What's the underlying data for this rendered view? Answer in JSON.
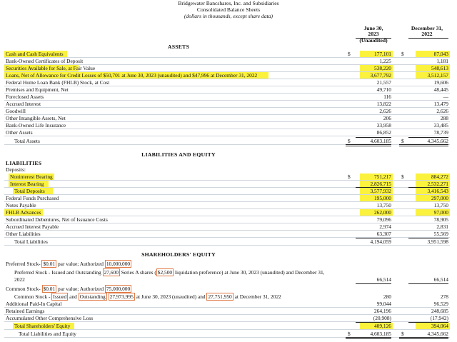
{
  "header": {
    "company": "Bridgewater Bancshares, Inc. and Subsidiaries",
    "statement": "Consolidated Balance Sheets",
    "units": "(dollars in thousands, except share data)"
  },
  "columns": {
    "col1_line1": "June 30,",
    "col1_line2": "2023",
    "col1_line3": "(Unaudited)",
    "col2_line1": "December 31,",
    "col2_line2": "2022"
  },
  "currency": "$",
  "assets": {
    "heading": "ASSETS",
    "rows": [
      {
        "label": "Cash and Cash Equivalents",
        "v1": "177,101",
        "v2": "87,043"
      },
      {
        "label": "Bank-Owned Certificates of Deposit",
        "v1": "1,225",
        "v2": "1,181"
      },
      {
        "label": "Securities Available for Sale, at Fair Value",
        "v1": "538,220",
        "v2": "548,613"
      },
      {
        "label": "Loans, Net of Allowance for Credit Losses of $50,701 at June 30, 2023 (unaudited) and $47,996 at December 31, 2022",
        "v1": "3,677,792",
        "v2": "3,512,157"
      },
      {
        "label": "Federal Home Loan Bank (FHLB) Stock, at Cost",
        "v1": "21,557",
        "v2": "19,606"
      },
      {
        "label": "Premises and Equipment, Net",
        "v1": "49,710",
        "v2": "48,445"
      },
      {
        "label": "Foreclosed Assets",
        "v1": "116",
        "v2": "—"
      },
      {
        "label": "Accrued Interest",
        "v1": "13,822",
        "v2": "13,479"
      },
      {
        "label": "Goodwill",
        "v1": "2,626",
        "v2": "2,626"
      },
      {
        "label": "Other Intangible Assets, Net",
        "v1": "206",
        "v2": "288"
      },
      {
        "label": "Bank-Owned Life Insurance",
        "v1": "33,958",
        "v2": "33,485"
      },
      {
        "label": "Other Assets",
        "v1": "86,852",
        "v2": "78,739"
      },
      {
        "label": "Total Assets",
        "v1": "4,603,185",
        "v2": "4,345,662"
      }
    ]
  },
  "liabilities": {
    "heading": "LIABILITIES AND EQUITY",
    "subheading": "LIABILITIES",
    "deposits_label": "Deposits:",
    "rows": [
      {
        "label": "Noninterest Bearing",
        "v1": "751,217",
        "v2": "884,272"
      },
      {
        "label": "Interest Bearing",
        "v1": "2,826,715",
        "v2": "2,532,271"
      },
      {
        "label": "Total Deposits",
        "v1": "3,577,932",
        "v2": "3,416,543"
      },
      {
        "label": "Federal Funds Purchased",
        "v1": "195,000",
        "v2": "297,000"
      },
      {
        "label": "Notes Payable",
        "v1": "13,750",
        "v2": "13,750"
      },
      {
        "label": "FHLB Advances",
        "v1": "262,000",
        "v2": "97,000"
      },
      {
        "label": "Subordinated Debentures, Net of Issuance Costs",
        "v1": "79,096",
        "v2": "78,905"
      },
      {
        "label": "Accrued Interest Payable",
        "v1": "2,974",
        "v2": "2,831"
      },
      {
        "label": "Other Liabilities",
        "v1": "63,307",
        "v2": "55,569"
      },
      {
        "label": "Total Liabilities",
        "v1": "4,194,059",
        "v2": "3,951,598"
      }
    ]
  },
  "equity": {
    "heading": "SHAREHOLDERS' EQUITY",
    "pref_a": "Preferred Stock- ",
    "pref_b": "$0.01",
    "pref_c": " par value; Authorized ",
    "pref_d": "10,000,000",
    "prefio_a": "Preferred Stock - Issued and Outstanding ",
    "prefio_b": "27,600",
    "prefio_c": " Series A shares (",
    "prefio_d": "$2,500",
    "prefio_e": " liquidation preference) at June 30, 2023 (unaudited) and December 31,",
    "prefio_line2": "2022",
    "prefio_v1": "66,514",
    "prefio_v2": "66,514",
    "com_a": "Common Stock- ",
    "com_b": "$0.01",
    "com_c": " par value; Authorized ",
    "com_d": "75,000,000",
    "comio_a": "Common Stock - ",
    "comio_b": "Issued",
    "comio_c": " and ",
    "comio_d": "Outstanding",
    "comio_e": " ",
    "comio_f": "27,973,995",
    "comio_g": " at June 30, 2023 (unaudited) and ",
    "comio_h": "27,751,950",
    "comio_i": " at December 31, 2022",
    "comio_v1": "280",
    "comio_v2": "278",
    "rows": [
      {
        "label": "Additional Paid-In Capital",
        "v1": "99,044",
        "v2": "96,529"
      },
      {
        "label": "Retained Earnings",
        "v1": "264,196",
        "v2": "248,685"
      },
      {
        "label": "Accumulated Other Comprehensive Loss",
        "v1": "(20,908)",
        "v2": "(17,942)"
      },
      {
        "label": "Total Shareholders' Equity",
        "v1": "409,126",
        "v2": "394,064"
      },
      {
        "label": "Total Liabilities and Equity",
        "v1": "4,603,185",
        "v2": "4,345,662"
      }
    ]
  }
}
